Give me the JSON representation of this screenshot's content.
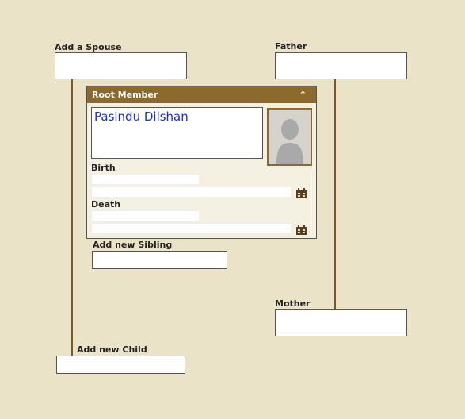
{
  "spouse": {
    "label": "Add a Spouse",
    "value": ""
  },
  "father": {
    "label": "Father",
    "value": ""
  },
  "root": {
    "title": "Root Member",
    "name": "Pasindu Dilshan",
    "birth_label": "Birth",
    "birth_place": "",
    "birth_date": "",
    "death_label": "Death",
    "death_place": "",
    "death_date": ""
  },
  "sibling": {
    "label": "Add new Sibling",
    "value": ""
  },
  "mother": {
    "label": "Mother",
    "value": ""
  },
  "child": {
    "label": "Add new Child",
    "value": ""
  },
  "icons": {
    "collapse": "chevron-up-icon",
    "birth_calendar": "calendar-icon",
    "death_calendar": "calendar-icon",
    "photo": "person-silhouette-icon"
  },
  "colors": {
    "background": "#ebe3c8",
    "header": "#8c6a2d",
    "connector": "#7a5a2a",
    "name_text": "#1a2ec8"
  }
}
